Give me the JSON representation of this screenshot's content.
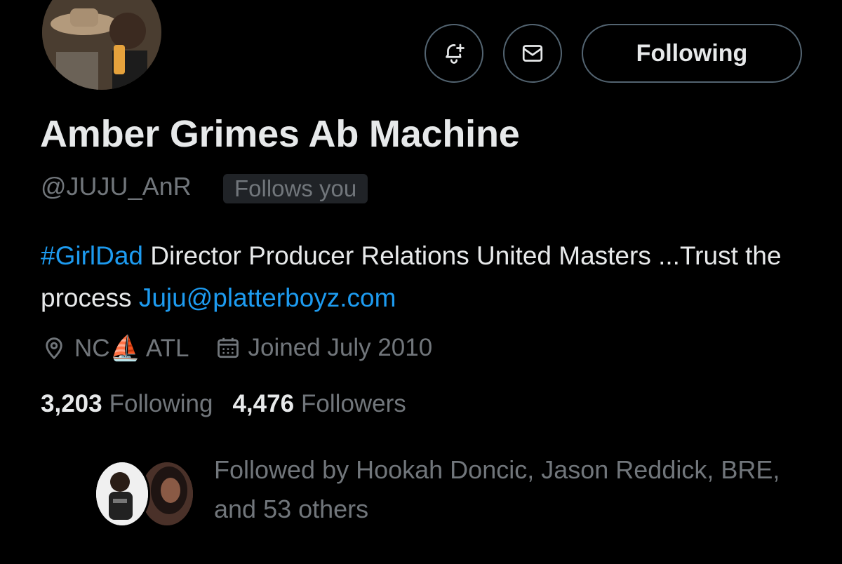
{
  "profile": {
    "display_name": "Amber Grimes Ab Machine",
    "handle": "@JUJU_AnR",
    "follows_you_badge": "Follows you"
  },
  "actions": {
    "notify_icon": "bell-plus-icon",
    "message_icon": "envelope-icon",
    "following_label": "Following"
  },
  "bio": {
    "hashtag": "#GirlDad",
    "text_1": " Director Producer Relations United Masters ...Trust the process ",
    "email": "Juju@platterboyz.com"
  },
  "meta": {
    "location": "NC⛵ ATL",
    "location_icon": "location-pin-icon",
    "joined": "Joined July 2010",
    "joined_icon": "calendar-icon"
  },
  "stats": {
    "following_count": "3,203",
    "following_label": "Following",
    "followers_count": "4,476",
    "followers_label": "Followers"
  },
  "followed_by": {
    "text": "Followed by Hookah Doncic, Jason Reddick, BRE, and 53 others"
  },
  "colors": {
    "background": "#000000",
    "primary_text": "#e7e9ea",
    "secondary_text": "#71767b",
    "link": "#1d9bf0",
    "border": "#536471"
  }
}
